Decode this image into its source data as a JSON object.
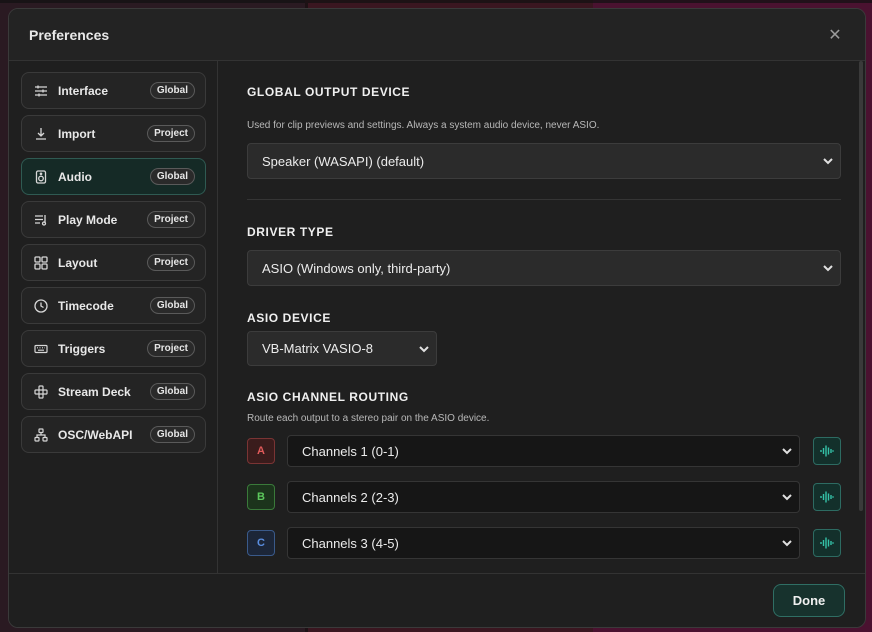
{
  "dialog": {
    "title": "Preferences"
  },
  "sidebar": {
    "items": [
      {
        "label": "Interface",
        "badge": "Global",
        "icon": "sliders-icon"
      },
      {
        "label": "Import",
        "badge": "Project",
        "icon": "download-icon"
      },
      {
        "label": "Audio",
        "badge": "Global",
        "icon": "speaker-icon",
        "active": true
      },
      {
        "label": "Play Mode",
        "badge": "Project",
        "icon": "playlist-icon"
      },
      {
        "label": "Layout",
        "badge": "Project",
        "icon": "grid-icon"
      },
      {
        "label": "Timecode",
        "badge": "Global",
        "icon": "clock-icon"
      },
      {
        "label": "Triggers",
        "badge": "Project",
        "icon": "keyboard-icon"
      },
      {
        "label": "Stream Deck",
        "badge": "Global",
        "icon": "stream-deck-icon"
      },
      {
        "label": "OSC/WebAPI",
        "badge": "Global",
        "icon": "network-icon"
      }
    ]
  },
  "audio": {
    "global_output": {
      "title": "GLOBAL OUTPUT DEVICE",
      "help": "Used for clip previews and settings. Always a system audio device, never ASIO.",
      "value": "Speaker (WASAPI) (default)"
    },
    "driver_type": {
      "title": "DRIVER TYPE",
      "value": "ASIO (Windows only, third-party)"
    },
    "asio_device": {
      "title": "ASIO DEVICE",
      "value": "VB-Matrix VASIO-8"
    },
    "routing": {
      "title": "ASIO CHANNEL ROUTING",
      "help": "Route each output to a stereo pair on the ASIO device.",
      "rows": [
        {
          "letter": "A",
          "value": "Channels 1 (0-1)",
          "color": "#e05a5a"
        },
        {
          "letter": "B",
          "value": "Channels 2 (2-3)",
          "color": "#5cc85c"
        },
        {
          "letter": "C",
          "value": "Channels 3 (4-5)",
          "color": "#5a8ee0"
        }
      ]
    }
  },
  "footer": {
    "done_label": "Done"
  },
  "colors": {
    "accent": "#35c3a9"
  }
}
